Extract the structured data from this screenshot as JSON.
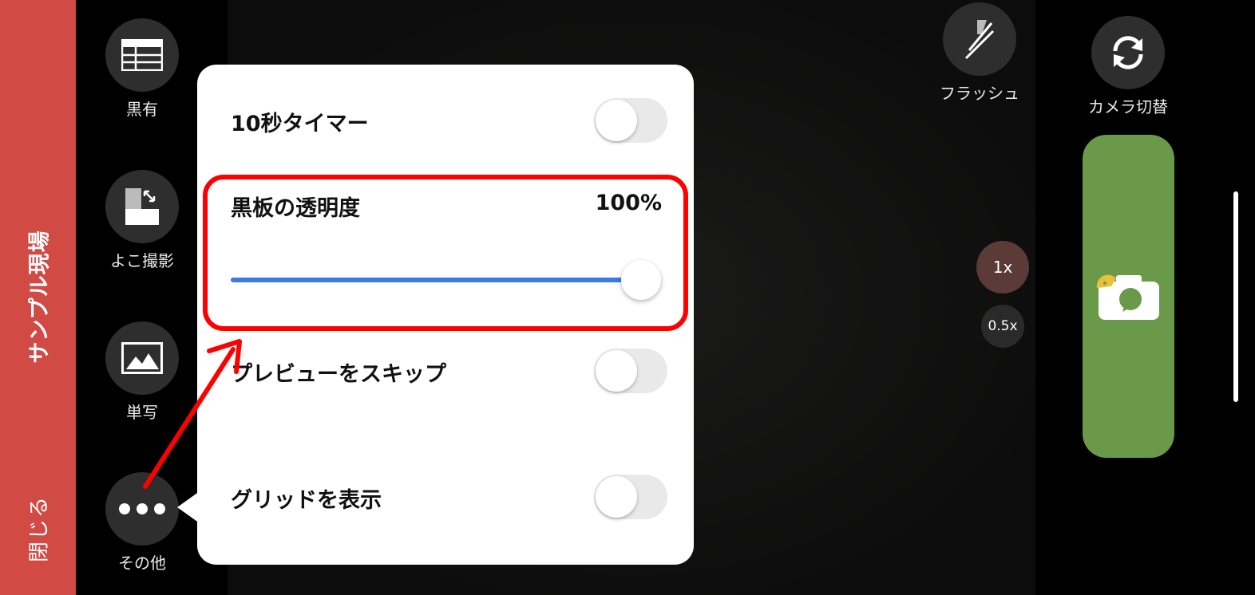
{
  "side_strip": {
    "site_name": "サンプル現場",
    "close_label": "閉じる",
    "color": "#d24a44"
  },
  "tools": [
    {
      "label": "黒有",
      "icon": "board-icon"
    },
    {
      "label": "よこ撮影",
      "icon": "landscape-shot-icon"
    },
    {
      "label": "単写",
      "icon": "photo-icon"
    },
    {
      "label": "その他",
      "icon": "more-icon"
    }
  ],
  "popup": {
    "timer": {
      "label": "10秒タイマー",
      "enabled": false
    },
    "opacity": {
      "label": "黒板の透明度",
      "value_text": "100%",
      "value": 1.0
    },
    "skip_preview": {
      "label": "プレビューをスキップ",
      "enabled": false
    },
    "grid": {
      "label": "グリッドを表示",
      "enabled": false
    },
    "accent_color": "#3a7be8"
  },
  "camera": {
    "flash_label": "フラッシュ",
    "switch_label": "カメラ切替",
    "zoom_options": [
      "1x",
      "0.5x"
    ],
    "selected_zoom": "1x",
    "shutter_color": "#6a9a49",
    "shutter_icon": "camera-icon"
  },
  "annotation": {
    "color": "#ff0000"
  }
}
